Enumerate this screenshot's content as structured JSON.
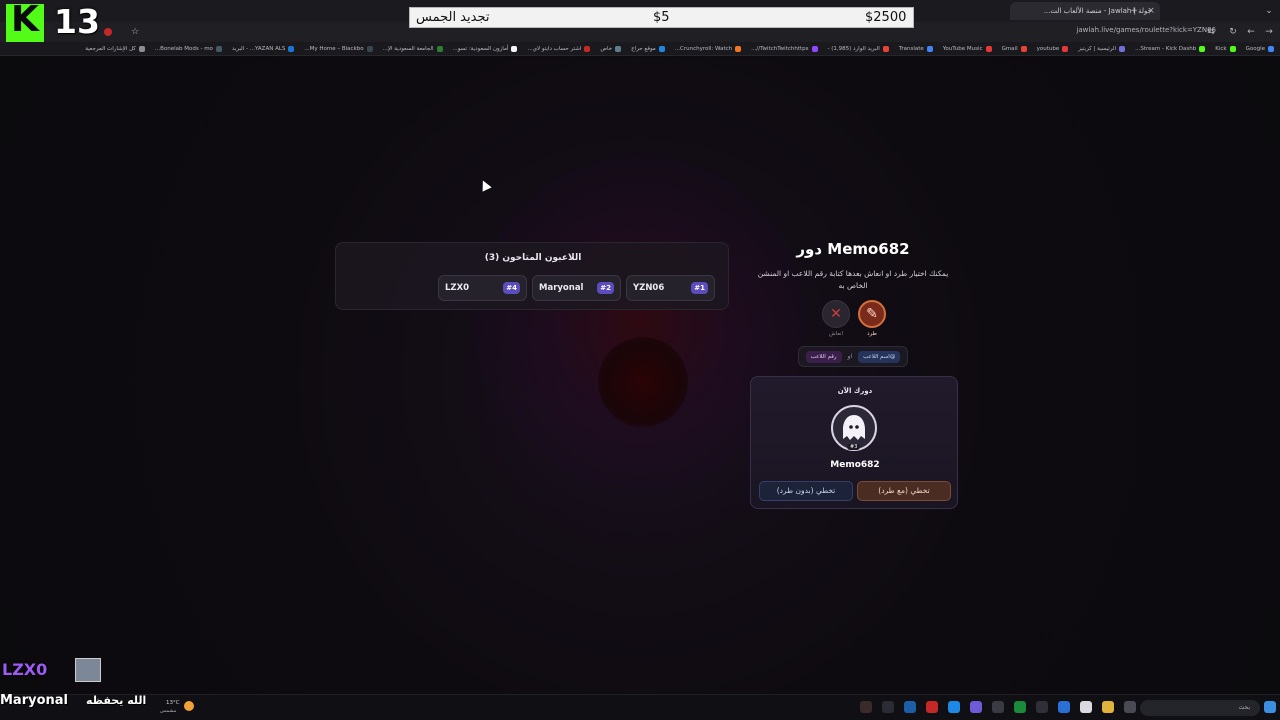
{
  "browser": {
    "tab_title": "جولة | Jawlah - منصة الألعاب الت...",
    "url": "jawlah.live/games/roulette?kick=YZN06",
    "bookmarks": [
      "كل الإشارات المرجعية",
      "Bonelab Mods - mo...",
      "YAZAN ALS... - البريد",
      "My Home – Blackbo...",
      "الجامعة السعودية الإ...",
      "أمازون السعودية: تسو...",
      "اشتر حساب دايتو لاي...",
      "خاص",
      "موقع حراج",
      "Crunchyroll: Watch...",
      "TwitchTwitchhttps//...",
      "البريد الوارد (1,985) -",
      "Translate",
      "YouTube Music",
      "Gmail",
      "youtube",
      "الرئيسية | كريتيز",
      "Stream - Kick Dashb...",
      "Kick",
      "Google"
    ]
  },
  "overlay": {
    "donation_goal_label": "تجديد الجمس",
    "donation_current": "$5",
    "donation_target": "$2500",
    "counter": "13",
    "kick_letter": "K",
    "chat_user_1": "LZX0",
    "chat_user_2": "Maryonal",
    "chat_message": "الله يحفظه"
  },
  "eliminated": {
    "title": "اللاعبون المتاحون (3)",
    "players": [
      {
        "name": "YZN06",
        "rank": "#1"
      },
      {
        "name": "Maryonal",
        "rank": "#2"
      },
      {
        "name": "LZX0",
        "rank": "#4"
      }
    ]
  },
  "turn": {
    "title": "دور Memo682",
    "description": "يمكنك اختيار طرد او انعاش بعدها كتابة رقم اللاعب او المنشن الخاص به",
    "action_kick": "طرد",
    "action_revive": "انعاش",
    "mode_by_name": "@اسم اللاعب",
    "mode_or": "او",
    "mode_by_number": "رقم اللاعب",
    "current_label": "دورك الآن",
    "avatar_number": "#3",
    "current_name": "Memo682",
    "skip_with_kick": "تخطي (مع طرد)",
    "skip_no_kick": "تخطي (بدون طرد)"
  },
  "taskbar": {
    "weather_temp": "13°C",
    "weather_label": "مشمس",
    "search_placeholder": "بحث"
  },
  "colors": {
    "accent_purple": "#5b4dbb",
    "kick_green": "#53fc18",
    "kick_button_brown": "#4a2c22",
    "skip_button_navy": "#1c2238"
  }
}
